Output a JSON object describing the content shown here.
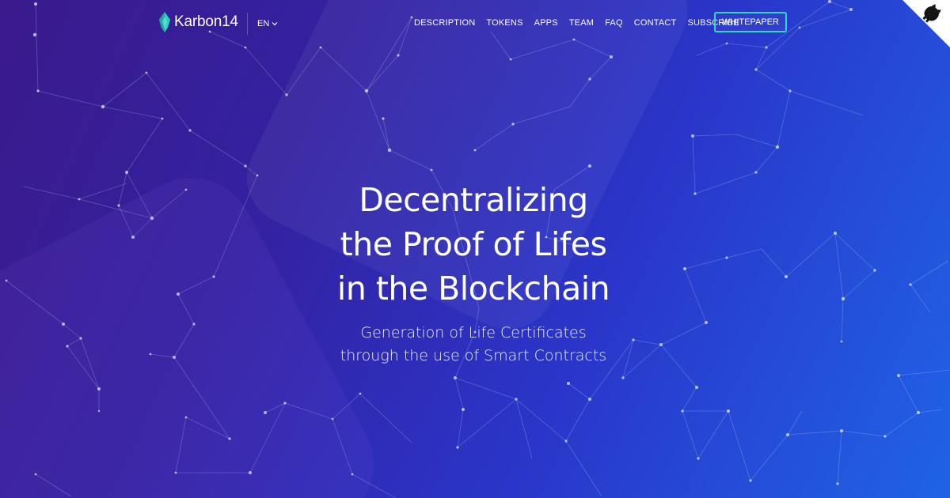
{
  "brand": {
    "name": "Karbon14",
    "logo_icon": "karbon14-leaf-icon",
    "accent_color": "#34d9c3"
  },
  "language": {
    "selected": "EN",
    "icon": "chevron-down-icon"
  },
  "nav": {
    "items": [
      {
        "label": "DESCRIPTION"
      },
      {
        "label": "TOKENS"
      },
      {
        "label": "APPS"
      },
      {
        "label": "TEAM"
      },
      {
        "label": "FAQ"
      },
      {
        "label": "CONTACT"
      },
      {
        "label": "SUBSCRIBE"
      }
    ],
    "cta_label": "WHITEPAPER"
  },
  "corner_icon": "github-octocat-icon",
  "hero": {
    "title_lines": [
      "Decentralizing",
      "the Proof of Lifes",
      "in the Blockchain"
    ],
    "subtitle_lines": [
      "Generation of Life Certificates",
      "through the use of Smart Contracts"
    ]
  },
  "colors": {
    "background_start": "#3a1a8c",
    "background_mid": "#2a35c9",
    "background_end": "#1f63e6"
  }
}
